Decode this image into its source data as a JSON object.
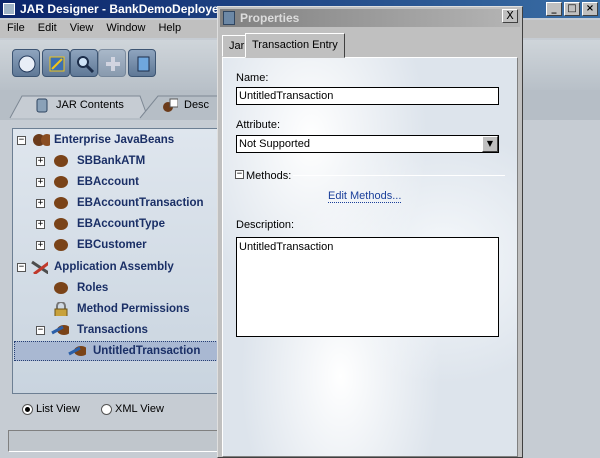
{
  "main_window": {
    "title": "JAR Designer - BankDemoDeployer",
    "menu": [
      "File",
      "Edit",
      "View",
      "Window",
      "Help"
    ],
    "toolbar_icons": [
      "compass-icon",
      "refresh-icon",
      "search-icon",
      "plus-icon",
      "document-icon"
    ],
    "tabs": [
      {
        "label": "JAR Contents",
        "icon": "jar-icon"
      },
      {
        "label": "Desc",
        "icon": "descriptor-icon"
      }
    ]
  },
  "tree": {
    "items": [
      {
        "label": "Enterprise JavaBeans",
        "level": 0,
        "expander": "−",
        "icon": "beans-icon"
      },
      {
        "label": "SBBankATM",
        "level": 1,
        "expander": "+",
        "icon": "bean-icon"
      },
      {
        "label": "EBAccount",
        "level": 1,
        "expander": "+",
        "icon": "bean-icon"
      },
      {
        "label": "EBAccountTransaction",
        "level": 1,
        "expander": "+",
        "icon": "bean-icon"
      },
      {
        "label": "EBAccountType",
        "level": 1,
        "expander": "+",
        "icon": "bean-icon"
      },
      {
        "label": "EBCustomer",
        "level": 1,
        "expander": "+",
        "icon": "bean-icon"
      },
      {
        "label": "Application Assembly",
        "level": 0,
        "expander": "−",
        "icon": "tools-icon"
      },
      {
        "label": "Roles",
        "level": 1,
        "expander": "",
        "icon": "bean-icon"
      },
      {
        "label": "Method Permissions",
        "level": 1,
        "expander": "",
        "icon": "lock-icon"
      },
      {
        "label": "Transactions",
        "level": 1,
        "expander": "−",
        "icon": "transaction-icon"
      },
      {
        "label": "UntitledTransaction",
        "level": 2,
        "expander": "",
        "icon": "transaction-icon"
      }
    ]
  },
  "view_options": {
    "list_view": "List View",
    "xml_view": "XML View"
  },
  "properties": {
    "title": "Properties",
    "close": "X",
    "tabs": [
      "Jar",
      "Transaction Entry"
    ],
    "name_label": "Name:",
    "name_value": "UntitledTransaction",
    "attribute_label": "Attribute:",
    "attribute_value": "Not Supported",
    "methods_label": "Methods:",
    "methods_toggle": "−",
    "edit_methods": "Edit Methods...",
    "description_label": "Description:",
    "description_value": "UntitledTransaction"
  },
  "colors": {
    "title_active": "#0a246a",
    "tree_text": "#1a2f66",
    "link": "#1a3f9a"
  }
}
